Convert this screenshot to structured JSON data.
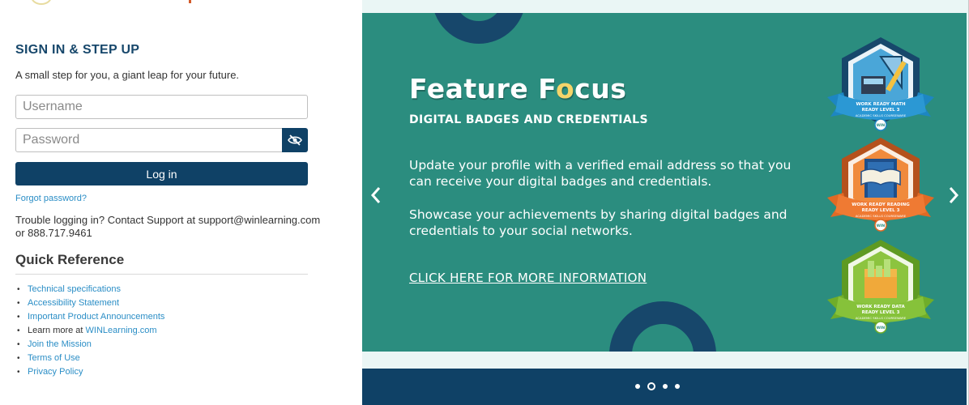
{
  "signin": {
    "title": "SIGN IN & STEP UP",
    "tagline": "A small step for you, a giant leap for your future.",
    "username_placeholder": "Username",
    "password_placeholder": "Password",
    "login_label": "Log in",
    "forgot_label": "Forgot password?",
    "trouble_text": "Trouble logging in? Contact Support at support@winlearning.com or 888.717.9461"
  },
  "quick_reference": {
    "title": "Quick Reference",
    "items": [
      {
        "label": "Technical specifications"
      },
      {
        "label": "Accessibility Statement"
      },
      {
        "label": "Important Product Announcements"
      },
      {
        "prefix": "Learn more at ",
        "label": "WINLearning.com"
      },
      {
        "label": "Join the Mission"
      },
      {
        "label": "Terms of Use"
      },
      {
        "label": "Privacy Policy"
      }
    ]
  },
  "slide": {
    "title_before": "Feature F",
    "title_o": "o",
    "title_after": "cus",
    "subtitle": "DIGITAL BADGES AND CREDENTIALS",
    "paragraph1": "Update your profile with a verified email address so that you can receive your digital badges and credentials.",
    "paragraph2": "Showcase your achievements by sharing digital badges and credentials to your social networks.",
    "link_label": "CLICK HERE FOR MORE INFORMATION",
    "badges": [
      {
        "line1": "WORK READY MATH",
        "line2": "READY LEVEL 3",
        "caption": "ACADEMIC SKILLS COURSEWARE",
        "logo": "WIN",
        "icon": "math-tools-icon",
        "hex_color": "#4aa6d8",
        "ribbon_color": "#1d86c2"
      },
      {
        "line1": "WORK READY READING",
        "line2": "READY LEVEL 3",
        "caption": "ACADEMIC SKILLS COURSEWARE",
        "logo": "WIN",
        "icon": "book-door-icon",
        "hex_color": "#f08a3c",
        "ribbon_color": "#e06a25"
      },
      {
        "line1": "WORK READY DATA",
        "line2": "READY LEVEL 3",
        "caption": "ACADEMIC SKILLS COURSEWARE",
        "logo": "WIN",
        "icon": "data-chart-icon",
        "hex_color": "#8cc43f",
        "ribbon_color": "#6fad2a"
      }
    ]
  },
  "carousel": {
    "slide_count": 4,
    "active_index": 1
  },
  "colors": {
    "navy": "#0f4166",
    "teal": "#2b8d7f",
    "link": "#2b8ec6",
    "yellow": "#f4d46a"
  }
}
